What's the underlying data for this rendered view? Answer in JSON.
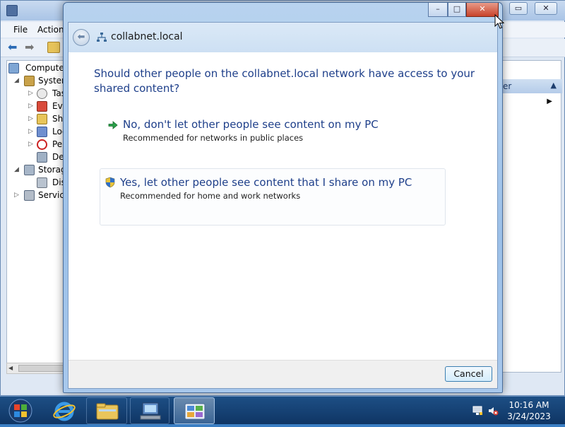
{
  "background_window": {
    "menu": [
      "File",
      "Action"
    ],
    "tree": [
      {
        "label": "Computer",
        "icon": "computer-icon"
      },
      {
        "label": "System",
        "icon": "tools-icon"
      },
      {
        "label": "Tas",
        "icon": "clock-icon"
      },
      {
        "label": "Eve",
        "icon": "event-viewer-icon"
      },
      {
        "label": "Sha",
        "icon": "shared-folders-icon"
      },
      {
        "label": "Loc",
        "icon": "users-icon"
      },
      {
        "label": "Per",
        "icon": "performance-icon"
      },
      {
        "label": "Dev",
        "icon": "device-manager-icon"
      },
      {
        "label": "Storag",
        "icon": "storage-icon"
      },
      {
        "label": "Dis",
        "icon": "disk-icon"
      },
      {
        "label": "Service",
        "icon": "services-icon"
      }
    ],
    "actions_header": "er"
  },
  "dialog": {
    "title": "collabnet.local",
    "question": "Should other people on the collabnet.local network have access to your shared content?",
    "options": [
      {
        "title": "No, don't let other people see content on my PC",
        "subtitle": "Recommended for networks in public places",
        "icon": "green-arrow-icon"
      },
      {
        "title": "Yes, let other people see content that I share on my PC",
        "subtitle": "Recommended for home and work networks",
        "icon": "uac-shield-icon"
      }
    ],
    "cancel_label": "Cancel",
    "window_buttons": {
      "minimize": "–",
      "maximize": "□",
      "close": "✕"
    }
  },
  "taskbar": {
    "items": [
      "start-button",
      "internet-explorer",
      "windows-explorer",
      "computer-management",
      "network-control-panel"
    ],
    "clock_time": "10:16 AM",
    "clock_date": "3/24/2023"
  },
  "colors": {
    "accent_link": "#1e3f8a",
    "close_button": "#c8432b",
    "taskbar": "#0f3564"
  }
}
